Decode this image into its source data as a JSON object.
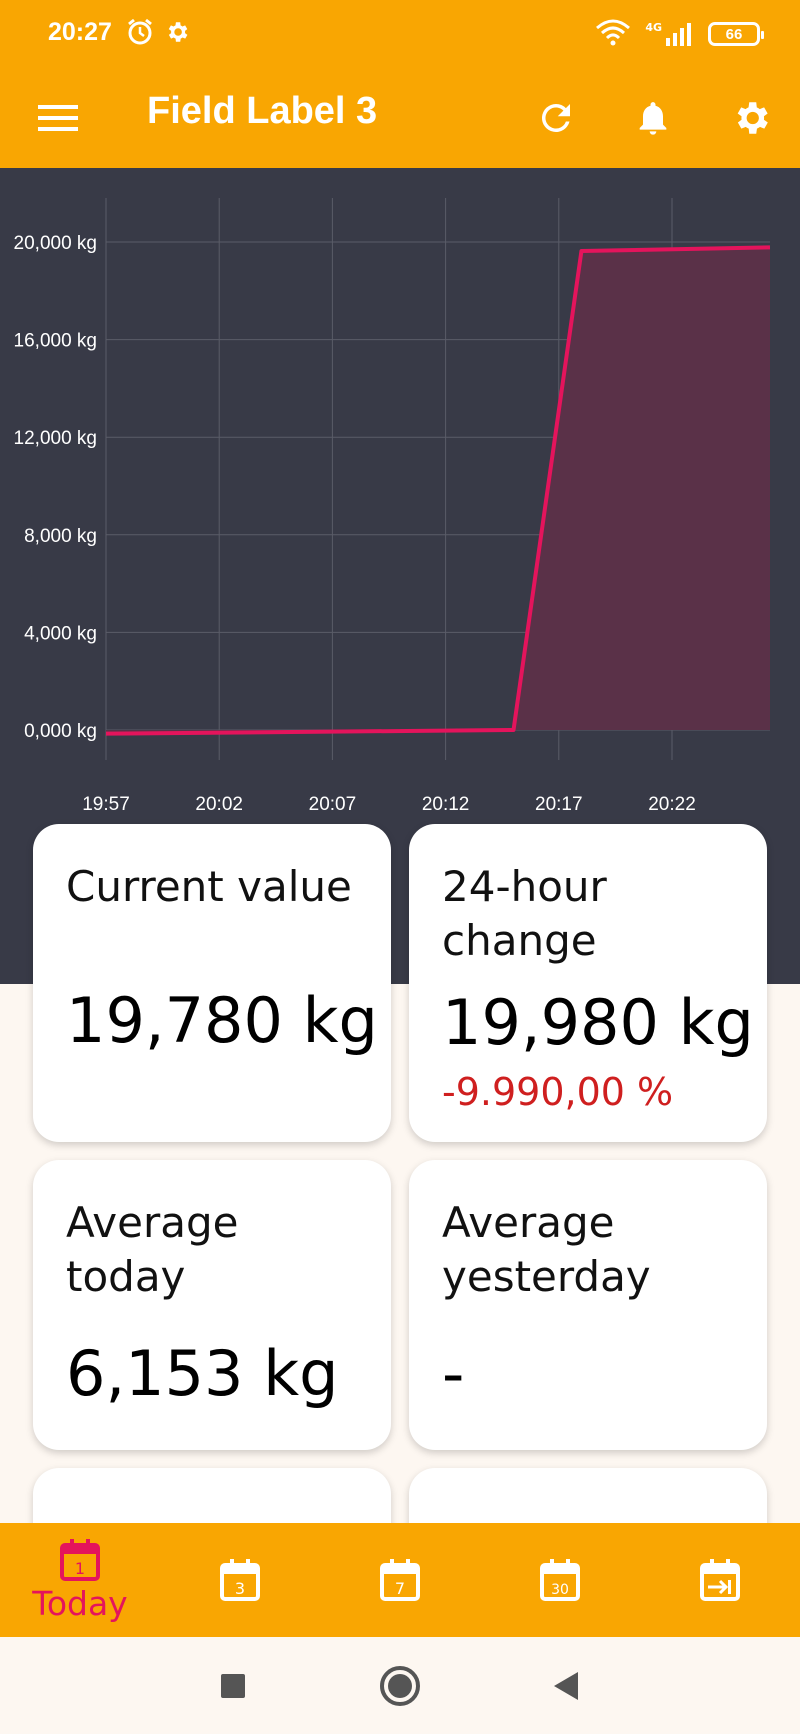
{
  "status_bar": {
    "time": "20:27",
    "network": "4G",
    "battery": "66"
  },
  "app_bar": {
    "title": "Field Label 3"
  },
  "chart_data": {
    "type": "area",
    "x": [
      "19:57",
      "20:15",
      "20:18",
      "20:29"
    ],
    "series": [
      {
        "values": [
          -150,
          0,
          19630,
          19780
        ]
      }
    ],
    "xticks": [
      "19:57",
      "20:02",
      "20:07",
      "20:12",
      "20:17",
      "20:22"
    ],
    "yticks": [
      0,
      4000,
      8000,
      12000,
      16000,
      20000
    ],
    "ytick_labels": [
      "0,000 kg",
      "4,000 kg",
      "8,000 kg",
      "12,000 kg",
      "16,000 kg",
      "20,000 kg"
    ],
    "ylim": [
      0,
      20000
    ],
    "grid": true,
    "line_color": "#e4145c",
    "fill_color": "#5a3148",
    "background": "#383a47"
  },
  "cards": [
    {
      "title_lines": [
        "Current value"
      ],
      "value": "19,780 kg"
    },
    {
      "title_lines": [
        "24-hour",
        "change"
      ],
      "value": "19,980 kg",
      "sub": "-9.990,00 %"
    },
    {
      "title_lines": [
        "Average",
        "today"
      ],
      "value": "6,153 kg"
    },
    {
      "title_lines": [
        "Average",
        "yesterday"
      ],
      "value": "-"
    }
  ],
  "bottom_nav": {
    "today_label": "Today",
    "today_number": "1",
    "three_day_number": "3",
    "seven_day_number": "7",
    "thirty_day_number": "30"
  },
  "colors": {
    "accent": "#f9a602",
    "active": "#e4145c",
    "negative": "#cf1f1f"
  }
}
